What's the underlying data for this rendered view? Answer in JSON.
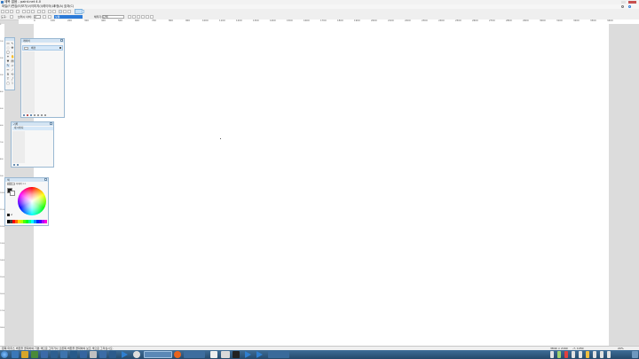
{
  "window": {
    "title": "제목 없음 - paint.net 4.0"
  },
  "menu": {
    "items": [
      {
        "label": "파일(F)"
      },
      {
        "label": "편집(E)"
      },
      {
        "label": "보기(V)"
      },
      {
        "label": "이미지(I)"
      },
      {
        "label": "레이어(L)"
      },
      {
        "label": "조정(A)"
      },
      {
        "label": "효과(C)"
      }
    ]
  },
  "toolbar": {
    "tool_label": "도구:",
    "brush_width_label": "브러시 너비:",
    "brush_width_value": "2",
    "antialias_label": "",
    "blend_value": "보통",
    "fill_label": "채우기:",
    "fill_value": "단색"
  },
  "ruler": {
    "top_ticks": [
      "0",
      "100",
      "200",
      "300",
      "400",
      "500",
      "600",
      "700",
      "800",
      "900",
      "1000",
      "1100",
      "1200",
      "1300",
      "1400",
      "1500",
      "1600",
      "1700",
      "1800",
      "1900",
      "2000",
      "2100",
      "2200",
      "2300",
      "2400",
      "2500",
      "2600",
      "2700",
      "2800",
      "2900",
      "3000",
      "3100",
      "3200",
      "3300",
      "3400"
    ],
    "left_ticks": [
      "0",
      "100",
      "200",
      "300",
      "400",
      "500",
      "600",
      "700",
      "800",
      "900",
      "1000",
      "1100",
      "1200",
      "1300",
      "1400",
      "1500",
      "1600",
      "1700",
      "1800"
    ]
  },
  "layers_panel": {
    "title": "레이어",
    "layer_name": "배경"
  },
  "history_panel": {
    "title": "기록",
    "item": "새 이미지"
  },
  "colors_panel": {
    "title": "색",
    "mode_label": "기본",
    "more_label": "자세히 >>"
  },
  "status": {
    "hint": "왼쪽 마우스 버튼을 클릭하여 기본 색으로 그리거나 오른쪽 버튼을 클릭하여 보조 색으로 그리십시오.",
    "size": "3840 × 2160",
    "position": "-7, 1450",
    "zoom": "20%"
  },
  "colors": {
    "accent": "#2b7bd8",
    "panel_border": "#9ab8d2",
    "primary_color": "#1e1e1e",
    "secondary_color": "#ffffff"
  }
}
